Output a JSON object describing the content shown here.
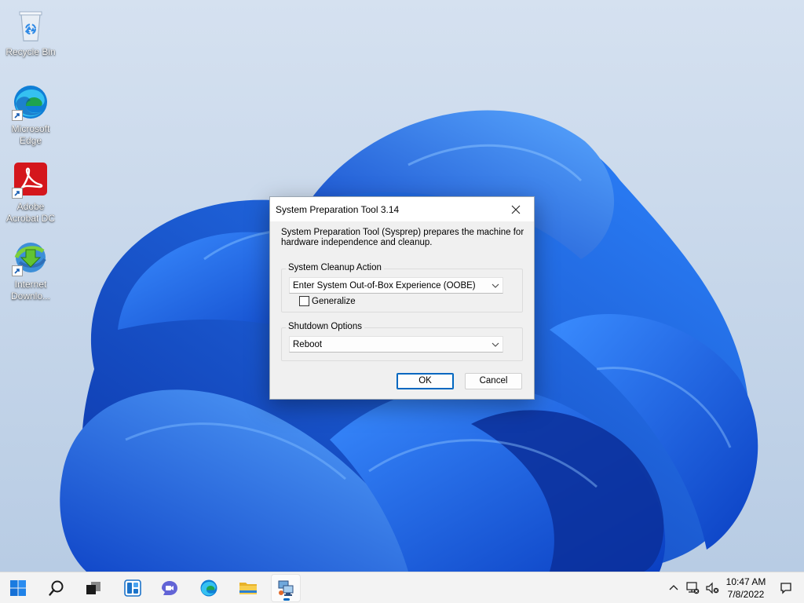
{
  "desktop": {
    "icons": [
      {
        "name": "recycle-bin",
        "label": "Recycle Bin"
      },
      {
        "name": "microsoft-edge",
        "label": "Microsoft Edge"
      },
      {
        "name": "adobe-acrobat",
        "label": "Adobe Acrobat DC"
      },
      {
        "name": "internet-download-manager",
        "label": "Internet Downlo..."
      }
    ]
  },
  "dialog": {
    "title": "System Preparation Tool 3.14",
    "description": "System Preparation Tool (Sysprep) prepares the machine for hardware independence and cleanup.",
    "cleanup": {
      "legend": "System Cleanup Action",
      "selected": "Enter System Out-of-Box Experience (OOBE)",
      "generalize_label": "Generalize",
      "generalize_checked": false
    },
    "shutdown": {
      "legend": "Shutdown Options",
      "selected": "Reboot"
    },
    "ok_label": "OK",
    "cancel_label": "Cancel"
  },
  "taskbar": {
    "items": [
      "start-icon",
      "search-icon",
      "task-view-icon",
      "widgets-icon",
      "chat-icon",
      "edge-icon",
      "file-explorer-icon",
      "sysprep-icon"
    ],
    "tray": [
      "chevron-up-icon",
      "network-icon",
      "volume-muted-icon",
      "notification-icon"
    ],
    "clock": {
      "time": "10:47 AM",
      "date": "7/8/2022"
    }
  },
  "colors": {
    "accent": "#0067c0",
    "wallpaper_bg": "#c9d7ea",
    "bloom_blue": "#1f63e6"
  }
}
